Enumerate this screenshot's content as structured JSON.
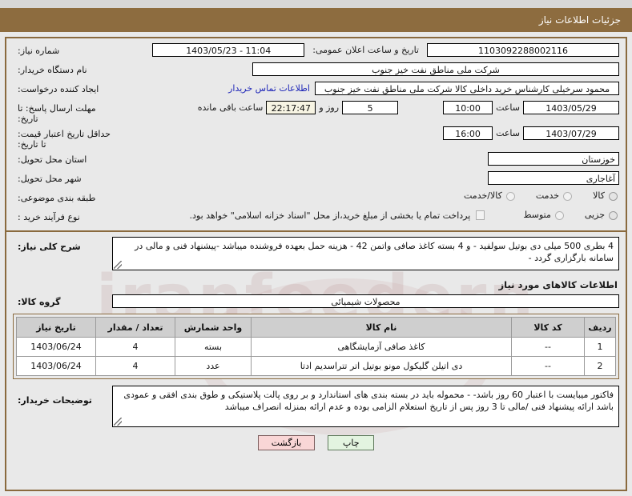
{
  "header": {
    "title": "جزئیات اطلاعات نیاز"
  },
  "form": {
    "need_number_label": "شماره نیاز:",
    "need_number_value": "1103092288002116",
    "announce_datetime_label": "تاریخ و ساعت اعلان عمومی:",
    "announce_datetime_value": "1403/05/23 - 11:04",
    "buyer_org_label": "نام دستگاه خریدار:",
    "buyer_org_value": "شرکت ملی مناطق نفت خیز جنوب",
    "requester_label": "ایجاد کننده درخواست:",
    "requester_value": "محمود سرخیلی کارشناس خرید داخلی کالا شرکت ملی مناطق نفت خیز جنوب",
    "buyer_contact_link": "اطلاعات تماس خریدار",
    "response_deadline_label": "مهلت ارسال پاسخ: تا تاریخ:",
    "response_deadline_date": "1403/05/29",
    "hour_label": "ساعت",
    "response_deadline_time": "10:00",
    "remaining_days": "5",
    "days_and_label": "روز و",
    "remaining_time": "22:17:47",
    "remaining_suffix": "ساعت باقی مانده",
    "price_validity_label": "حداقل تاریخ اعتبار قیمت: تا تاریخ:",
    "price_validity_date": "1403/07/29",
    "price_validity_time": "16:00",
    "province_label": "استان محل تحویل:",
    "province_value": "خوزستان",
    "city_label": "شهر محل تحویل:",
    "city_value": "آغاجاری",
    "category_label": "طبقه بندی موضوعی:",
    "category_options": [
      "کالا",
      "خدمت",
      "کالا/خدمت"
    ],
    "category_selected": "کالا",
    "process_label": "نوع فرآیند خرید :",
    "process_options": [
      "جزیی",
      "متوسط"
    ],
    "process_selected": "جزیی",
    "treasury_checkbox_text": "پرداخت تمام یا بخشی از مبلغ خرید،از محل \"اسناد خزانه اسلامی\" خواهد بود.",
    "treasury_checked": false
  },
  "summary": {
    "label": "شرح کلی نیاز:",
    "text": "4 بطری 500 میلی دی بوتیل سولفید - و 4 بسته کاغذ صافی واتمن 42 - هزینه حمل بعهده فروشنده میباشد -پیشنهاد فنی و مالی در سامانه بارگزاری گردد -"
  },
  "goods": {
    "section_title": "اطلاعات کالاهای مورد نیاز",
    "group_label": "گروه کالا:",
    "group_value": "محصولات شیمیائی",
    "columns": [
      "ردیف",
      "کد کالا",
      "نام کالا",
      "واحد شمارش",
      "تعداد / مقدار",
      "تاریخ نیاز"
    ],
    "rows": [
      {
        "row": "1",
        "code": "--",
        "name": "کاغذ صافی آزمایشگاهی",
        "unit": "بسته",
        "qty": "4",
        "date": "1403/06/24"
      },
      {
        "row": "2",
        "code": "--",
        "name": "دی اتیلن گلیکول مونو بوتیل اتر تتراسدیم ادتا",
        "unit": "عدد",
        "qty": "4",
        "date": "1403/06/24"
      }
    ]
  },
  "notes": {
    "label": "توضیحات خریدار:",
    "text": "فاکتور میبایست با اعتبار 60 روز باشد- - محموله باید در بسته بندی های استاندارد و بر روی پالت پلاستیکی و طوق بندی افقی و عمودی باشد ارائه پیشنهاد فنی /مالی تا 3 روز پس از تاریخ استعلام الزامی بوده و عدم ارائه بمنزله انصراف میباشد"
  },
  "footer": {
    "print_label": "چاپ",
    "back_label": "بازگشت"
  }
}
